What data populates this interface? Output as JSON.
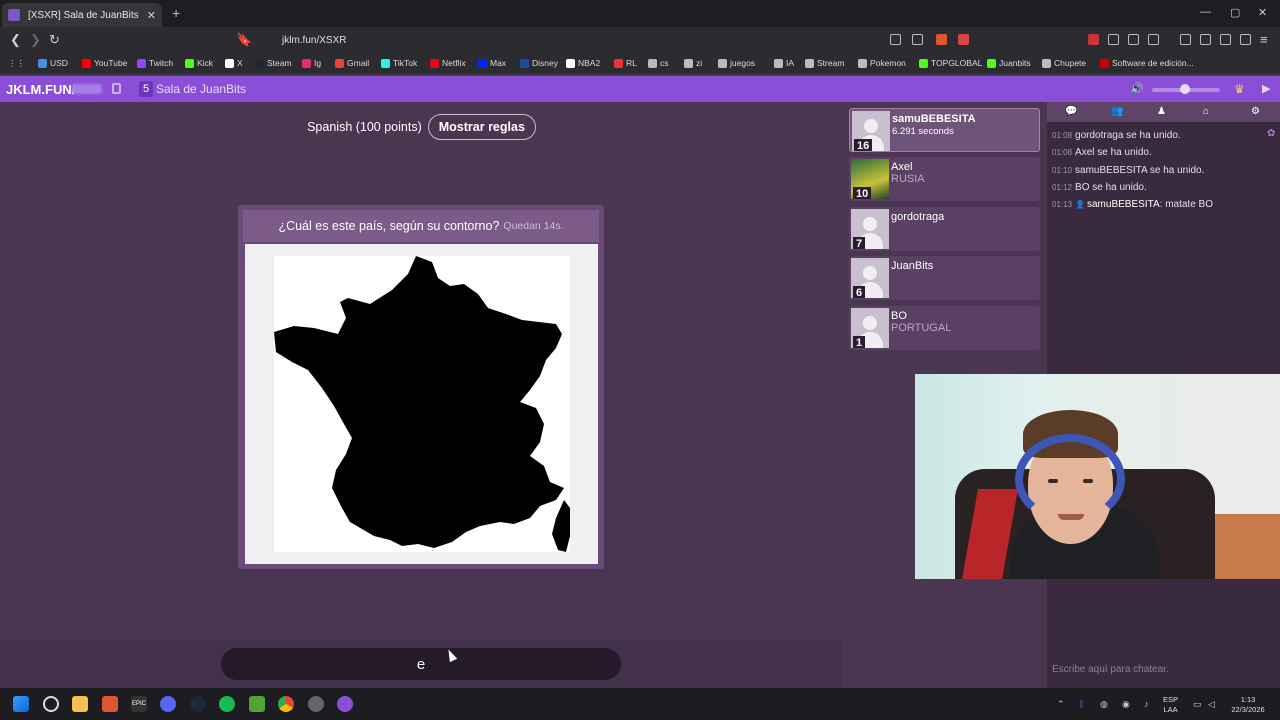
{
  "browser": {
    "tab_title": "[XSXR] Sala de JuanBits",
    "url": "jklm.fun/XSXR",
    "bookmarks": [
      "USD",
      "YouTube",
      "Twitch",
      "Kick",
      "X",
      "Steam",
      "Ig",
      "Gmail",
      "TikTok",
      "Netflix",
      "Max",
      "Disney",
      "NBA2",
      "RL",
      "cs",
      "zi",
      "juegos",
      "IA",
      "Stream",
      "Pokemon",
      "TOPGLOBAL",
      "Juanbits",
      "Chupete",
      "Software de edición..."
    ]
  },
  "header": {
    "brand": "JKLM.FUN/",
    "player_count": "5",
    "room_name": "Sala de JuanBits"
  },
  "game": {
    "language_label": "Spanish (100 points)",
    "rules_button": "Mostrar reglas",
    "question": "¿Cuál es este país, según su contorno?",
    "timer": "Quedan 14s.",
    "answer_value": "e"
  },
  "players": [
    {
      "name": "samuBEBESITA",
      "sub": "6.291 seconds",
      "score": "16",
      "highlight": true
    },
    {
      "name": "Axel",
      "sub": "RUSIA",
      "score": "10",
      "photo": true
    },
    {
      "name": "gordotraga",
      "sub": "",
      "score": "7"
    },
    {
      "name": "JuanBits",
      "sub": "",
      "score": "6"
    },
    {
      "name": "BO",
      "sub": "PORTUGAL",
      "score": "1"
    }
  ],
  "chat": {
    "messages": [
      {
        "time": "01:08",
        "text": "gordotraga se ha unido."
      },
      {
        "time": "01:08",
        "text": "Axel se ha unido."
      },
      {
        "time": "01:10",
        "text": "samuBEBESITA se ha unido."
      },
      {
        "time": "01:12",
        "text": "BO se ha unido."
      },
      {
        "time": "01:13",
        "user": "samuBEBESITA",
        "text": "matate BO"
      }
    ],
    "placeholder": "Escribe aquí para chatear."
  },
  "taskbar": {
    "lang": "ESP",
    "lang2": "LAA",
    "time": "1:13",
    "date": "22/3/2026"
  },
  "colors": {
    "header_purple": "#8a4fd6",
    "bg_purple": "#4b3652",
    "card": "#6a4a78"
  },
  "icons": [
    "back-icon",
    "forward-icon",
    "reload-icon",
    "bookmark-icon",
    "lock-icon",
    "volume-icon",
    "crown-icon",
    "play-icon",
    "chat-icon",
    "settings-icon",
    "windows-icon",
    "search-icon"
  ]
}
